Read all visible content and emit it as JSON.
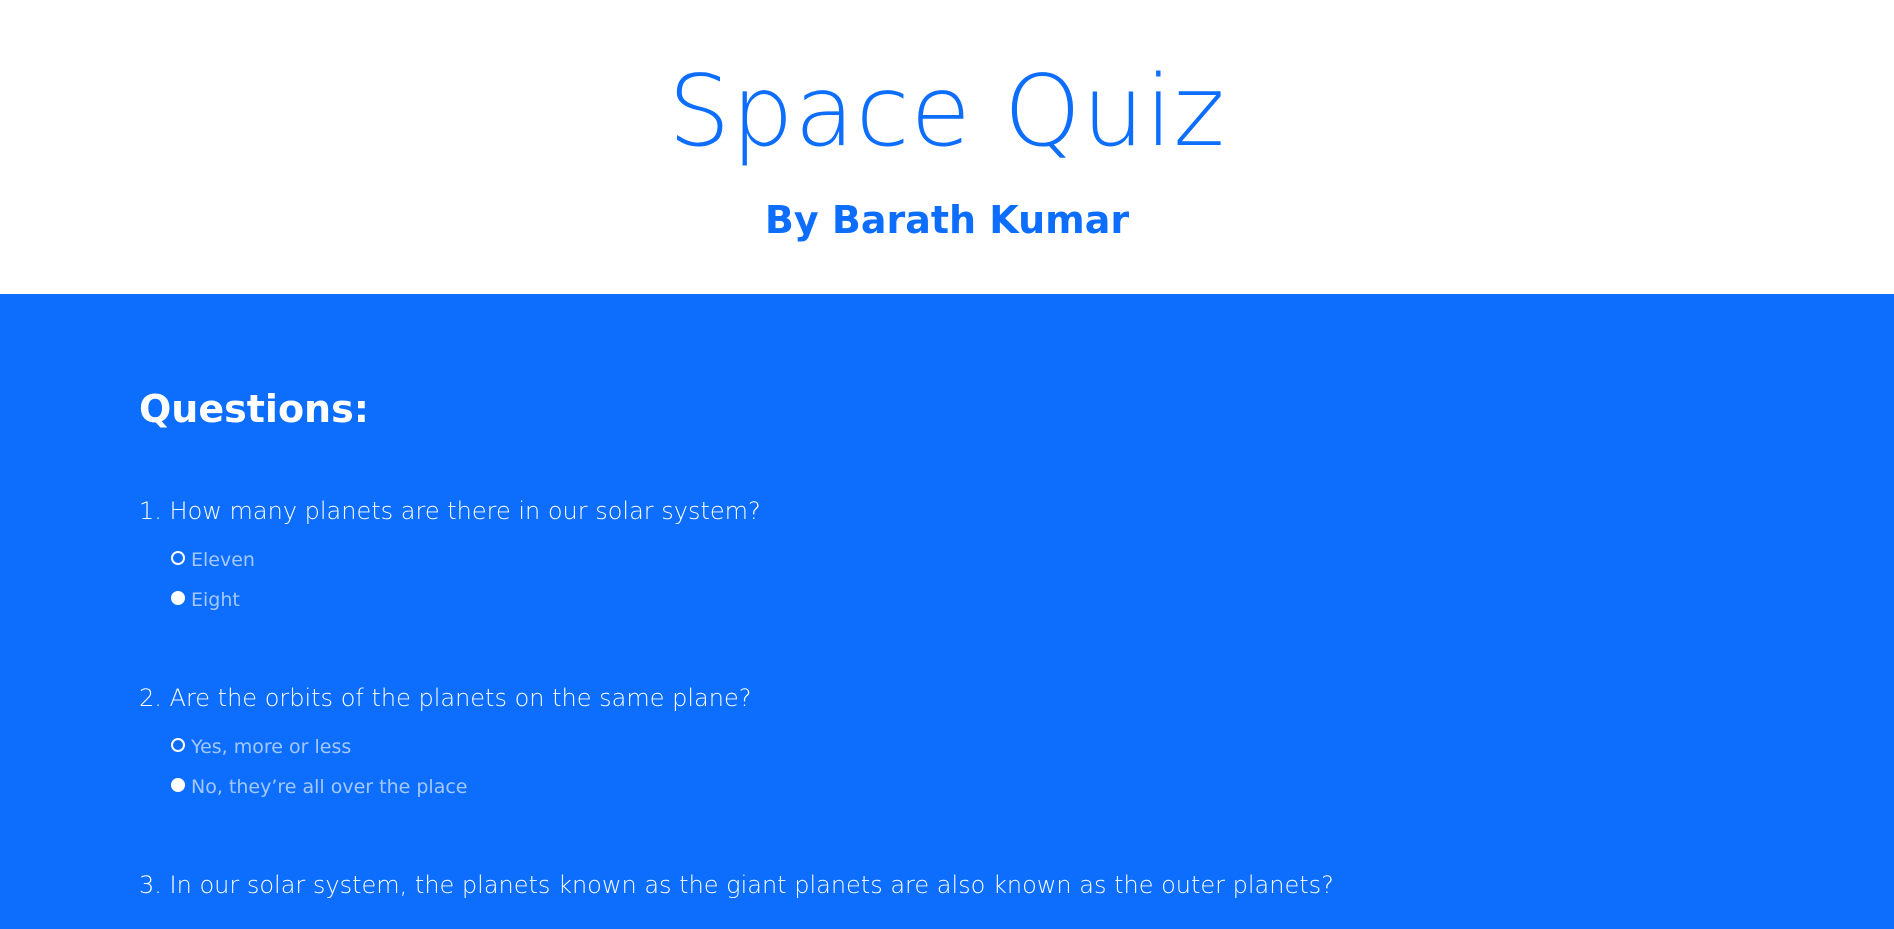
{
  "header": {
    "title": "Space Quiz",
    "subtitle": "By Barath Kumar"
  },
  "main": {
    "heading": "Questions:",
    "questions": [
      {
        "text": "1. How many planets are there in our solar system?",
        "options": [
          "Eleven",
          "Eight"
        ]
      },
      {
        "text": "2. Are the orbits of the planets on the same plane?",
        "options": [
          "Yes, more or less",
          "No, they’re all over the place"
        ]
      },
      {
        "text": "3. In our solar system, the planets known as the giant planets are also known as the outer planets?",
        "options": []
      }
    ]
  },
  "colors": {
    "primary": "#0d6efd",
    "background": "#ffffff",
    "text_on_primary": "#ffffff"
  }
}
